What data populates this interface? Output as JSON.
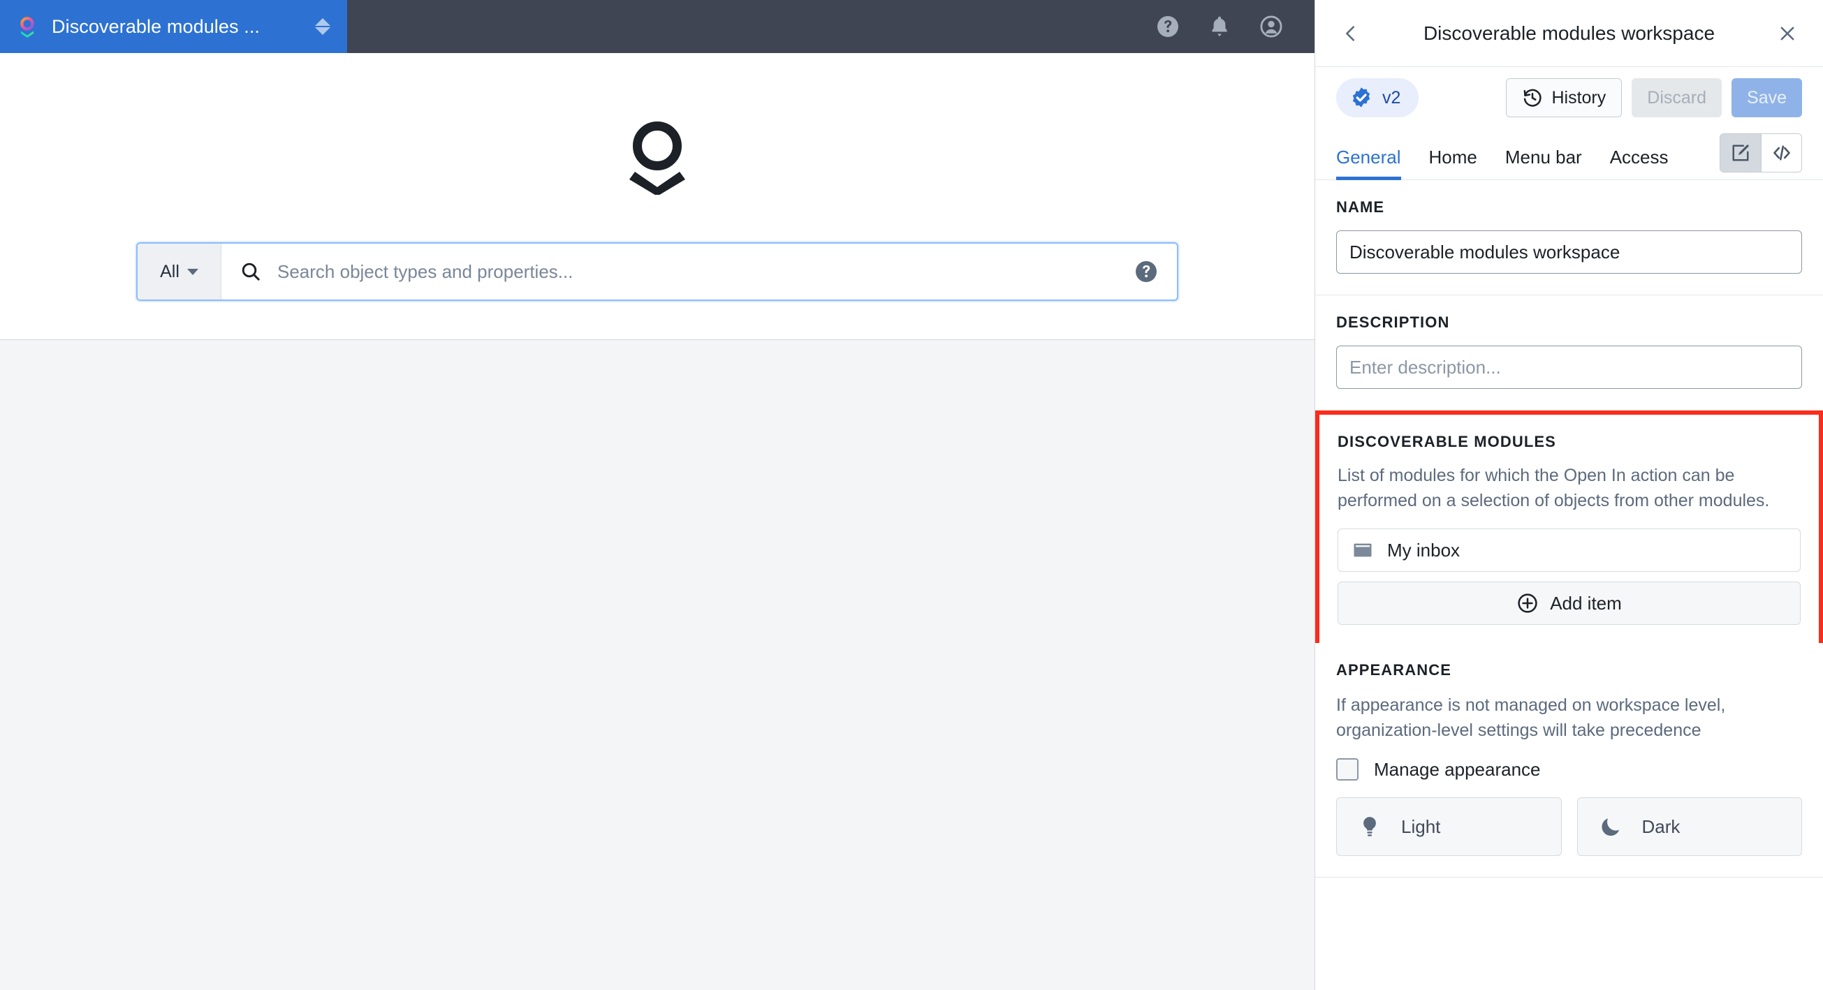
{
  "workspace_tab": {
    "title": "Discoverable modules ...",
    "logo_icon": "ring-chevron-logo-icon",
    "sort_icon": "up-down-arrows-icon"
  },
  "topbar": {
    "help_icon": "question-circle-icon",
    "notifications_icon": "bell-icon",
    "profile_icon": "user-avatar-icon"
  },
  "main": {
    "logo_icon": "ring-chevron-logo-icon",
    "search": {
      "scope_label": "All",
      "scope_caret_icon": "chevron-down-icon",
      "search_icon": "magnifier-icon",
      "placeholder": "Search object types and properties...",
      "help_icon": "question-circle-icon"
    }
  },
  "panel": {
    "back_icon": "chevron-left-icon",
    "title": "Discoverable modules workspace",
    "close_icon": "close-x-icon",
    "toolbar": {
      "version_badge_icon": "verified-check-badge-icon",
      "version_label": "v2",
      "history_icon": "history-clock-icon",
      "history_label": "History",
      "discard_label": "Discard",
      "save_label": "Save"
    },
    "tabs": [
      {
        "label": "General",
        "active": true
      },
      {
        "label": "Home",
        "active": false
      },
      {
        "label": "Menu bar",
        "active": false
      },
      {
        "label": "Access",
        "active": false
      }
    ],
    "view_toggle": [
      {
        "icon": "design-edit-icon",
        "active": true
      },
      {
        "icon": "code-brackets-icon",
        "active": false
      }
    ],
    "sections": {
      "name": {
        "title": "NAME",
        "value": "Discoverable modules workspace"
      },
      "description": {
        "title": "DESCRIPTION",
        "placeholder": "Enter description..."
      },
      "discoverable_modules": {
        "title": "DISCOVERABLE MODULES",
        "description": "List of modules for which the Open In action can be performed on a selection of objects from other modules.",
        "highlight_color": "#fc2b1b",
        "items": [
          {
            "label": "My inbox",
            "icon": "inbox-panel-icon"
          }
        ],
        "add_item_icon": "plus-circle-icon",
        "add_item_label": "Add item"
      },
      "appearance": {
        "title": "APPEARANCE",
        "description": "If appearance is not managed on workspace level, organization-level settings will take precedence",
        "manage_checkbox_label": "Manage appearance",
        "manage_checked": false,
        "themes": [
          {
            "label": "Light",
            "icon": "lightbulb-icon"
          },
          {
            "label": "Dark",
            "icon": "moon-icon"
          }
        ]
      }
    }
  },
  "colors": {
    "accent_blue": "#2d72d2",
    "tab_blue": "#2d72d2",
    "topbar_dark": "#3f4552",
    "highlight_red": "#fc2b1b",
    "badge_blue": "#1f4ba5"
  }
}
